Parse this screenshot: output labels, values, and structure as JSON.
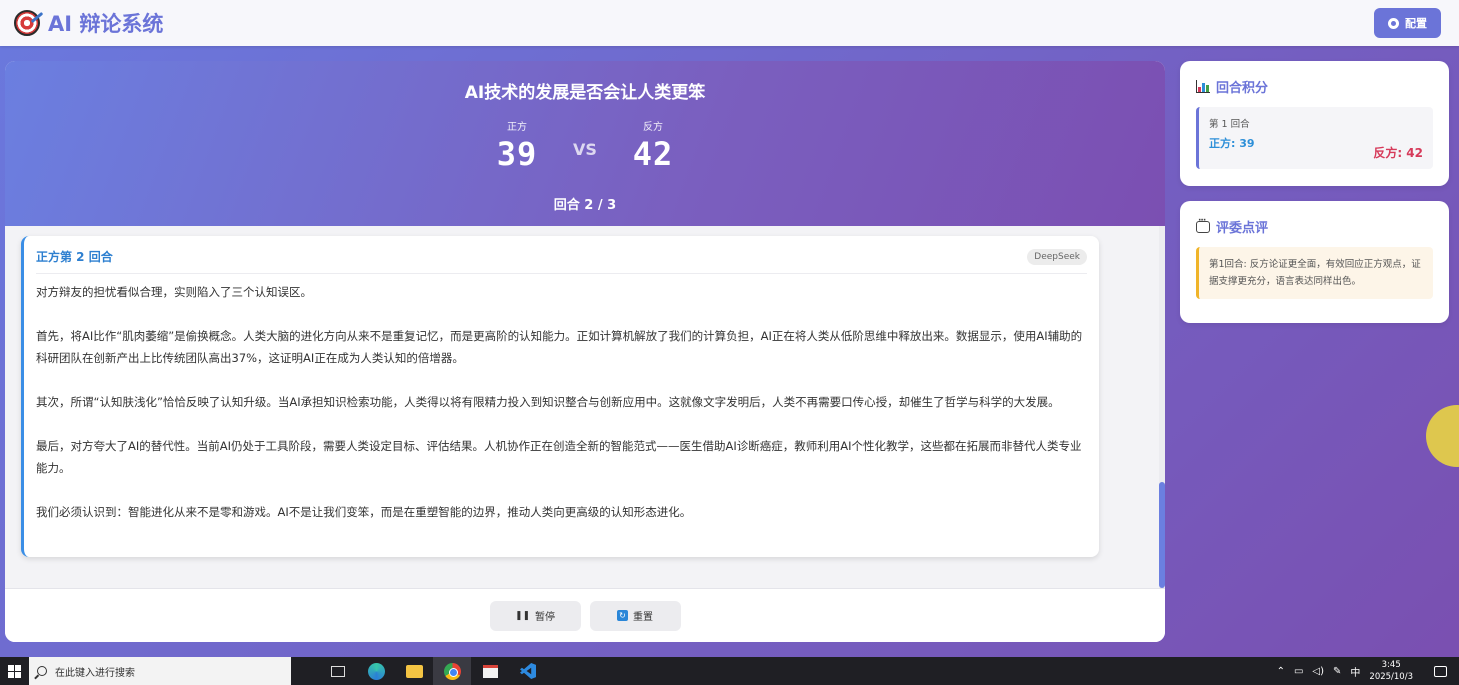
{
  "header": {
    "app_title": "AI 辩论系统",
    "config_label": "配置"
  },
  "debate": {
    "topic": "AI技术的发展是否会让人类更笨",
    "pro": {
      "label": "正方",
      "score": "39"
    },
    "con": {
      "label": "反方",
      "score": "42"
    },
    "vs_label": "VS",
    "round_label": "回合 2 / 3"
  },
  "message": {
    "title": "正方第 2 回合",
    "model": "DeepSeek",
    "paragraphs": [
      "对方辩友的担忧看似合理，实则陷入了三个认知误区。",
      "首先，将AI比作“肌肉萎缩”是偷换概念。人类大脑的进化方向从来不是重复记忆，而是更高阶的认知能力。正如计算机解放了我们的计算负担，AI正在将人类从低阶思维中释放出来。数据显示，使用AI辅助的科研团队在创新产出上比传统团队高出37%，这证明AI正在成为人类认知的倍增器。",
      "其次，所谓“认知肤浅化”恰恰反映了认知升级。当AI承担知识检索功能，人类得以将有限精力投入到知识整合与创新应用中。这就像文字发明后，人类不再需要口传心授，却催生了哲学与科学的大发展。",
      "最后，对方夸大了AI的替代性。当前AI仍处于工具阶段，需要人类设定目标、评估结果。人机协作正在创造全新的智能范式——医生借助AI诊断癌症，教师利用AI个性化教学，这些都在拓展而非替代人类专业能力。",
      "我们必须认识到：智能进化从来不是零和游戏。AI不是让我们变笨，而是在重塑智能的边界，推动人类向更高级的认知形态进化。"
    ]
  },
  "controls": {
    "pause_label": "暂停",
    "reset_label": "重置"
  },
  "scores_panel": {
    "title": "回合积分",
    "rounds": [
      {
        "round": "第 1 回合",
        "pro": "正方: 39",
        "con": "反方: 42"
      }
    ]
  },
  "judge_panel": {
    "title": "评委点评",
    "comment": "第1回合: 反方论证更全面，有效回应正方观点，证据支撑更充分，语言表达同样出色。"
  },
  "taskbar": {
    "search_placeholder": "在此键入进行搜索",
    "ime": "中",
    "time": "3:45",
    "date": "2025/10/3"
  },
  "colors": {
    "accent": "#6b74d8",
    "pro": "#2d8fd8",
    "con": "#d63a5a",
    "judge_border": "#f0b429"
  }
}
